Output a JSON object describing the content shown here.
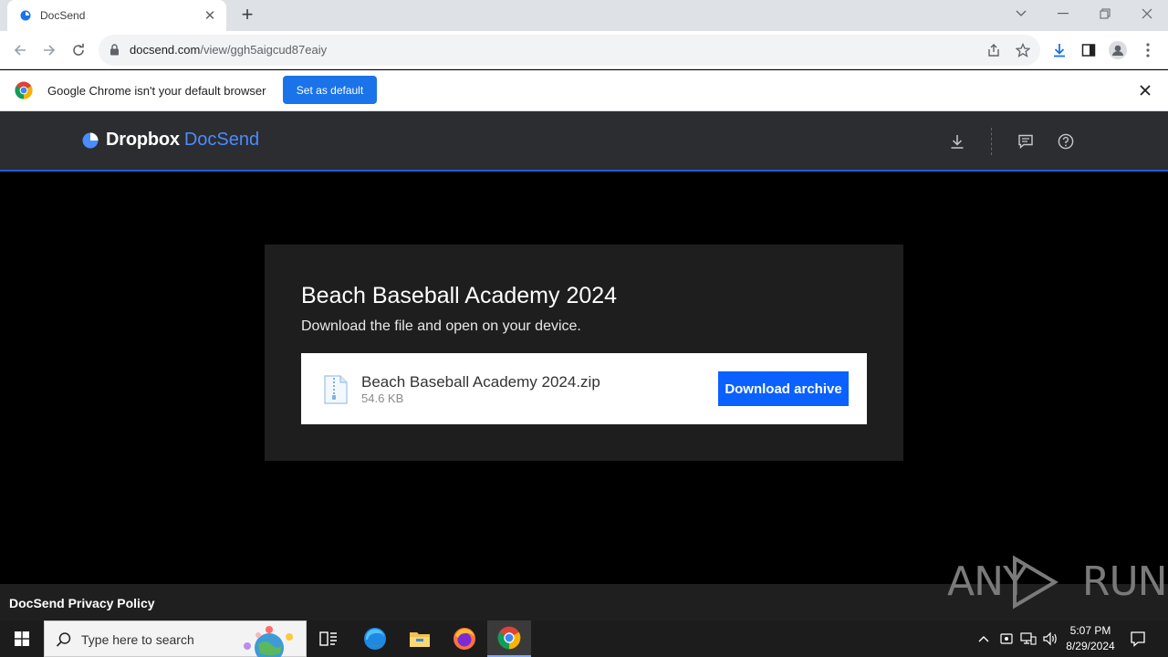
{
  "browser": {
    "tab": {
      "title": "DocSend",
      "favicon": "docsend-favicon",
      "close_icon": "close-icon"
    },
    "new_tab_icon": "plus-icon",
    "window_controls": [
      "chevron-down-icon",
      "minimize-icon",
      "restore-icon",
      "close-icon"
    ],
    "url": {
      "host": "docsend.com",
      "path": "/view/ggh5aigcud87eaiy"
    },
    "toolbar_icons": [
      "back-icon",
      "forward-icon",
      "reload-icon",
      "lock-icon",
      "share-icon",
      "star-icon",
      "download-icon",
      "side-panel-icon",
      "profile-icon",
      "more-icon"
    ]
  },
  "infobar": {
    "message": "Google Chrome isn't your default browser",
    "button": "Set as default"
  },
  "docsend": {
    "logo": {
      "brand": "Dropbox",
      "product": "DocSend"
    },
    "header_icons": [
      "download-icon",
      "comment-icon",
      "help-icon"
    ],
    "accent": "#0a61fe",
    "card": {
      "title": "Beach Baseball Academy 2024",
      "subtitle": "Download the file and open on your device.",
      "file": {
        "name": "Beach Baseball Academy 2024.zip",
        "size": "54.6 KB",
        "icon": "zip-file-icon"
      },
      "button": "Download archive"
    },
    "footer": {
      "policy_link": "DocSend Privacy Policy"
    }
  },
  "watermark": {
    "text": "ANY RUN"
  },
  "taskbar": {
    "search_placeholder": "Type here to search",
    "apps": [
      "task-view-icon",
      "edge-icon",
      "file-explorer-icon",
      "firefox-icon",
      "chrome-icon"
    ],
    "tray_icons": [
      "chevron-up-icon",
      "meet-icon",
      "network-icon",
      "volume-icon"
    ],
    "time": "5:07 PM",
    "date": "8/29/2024"
  }
}
